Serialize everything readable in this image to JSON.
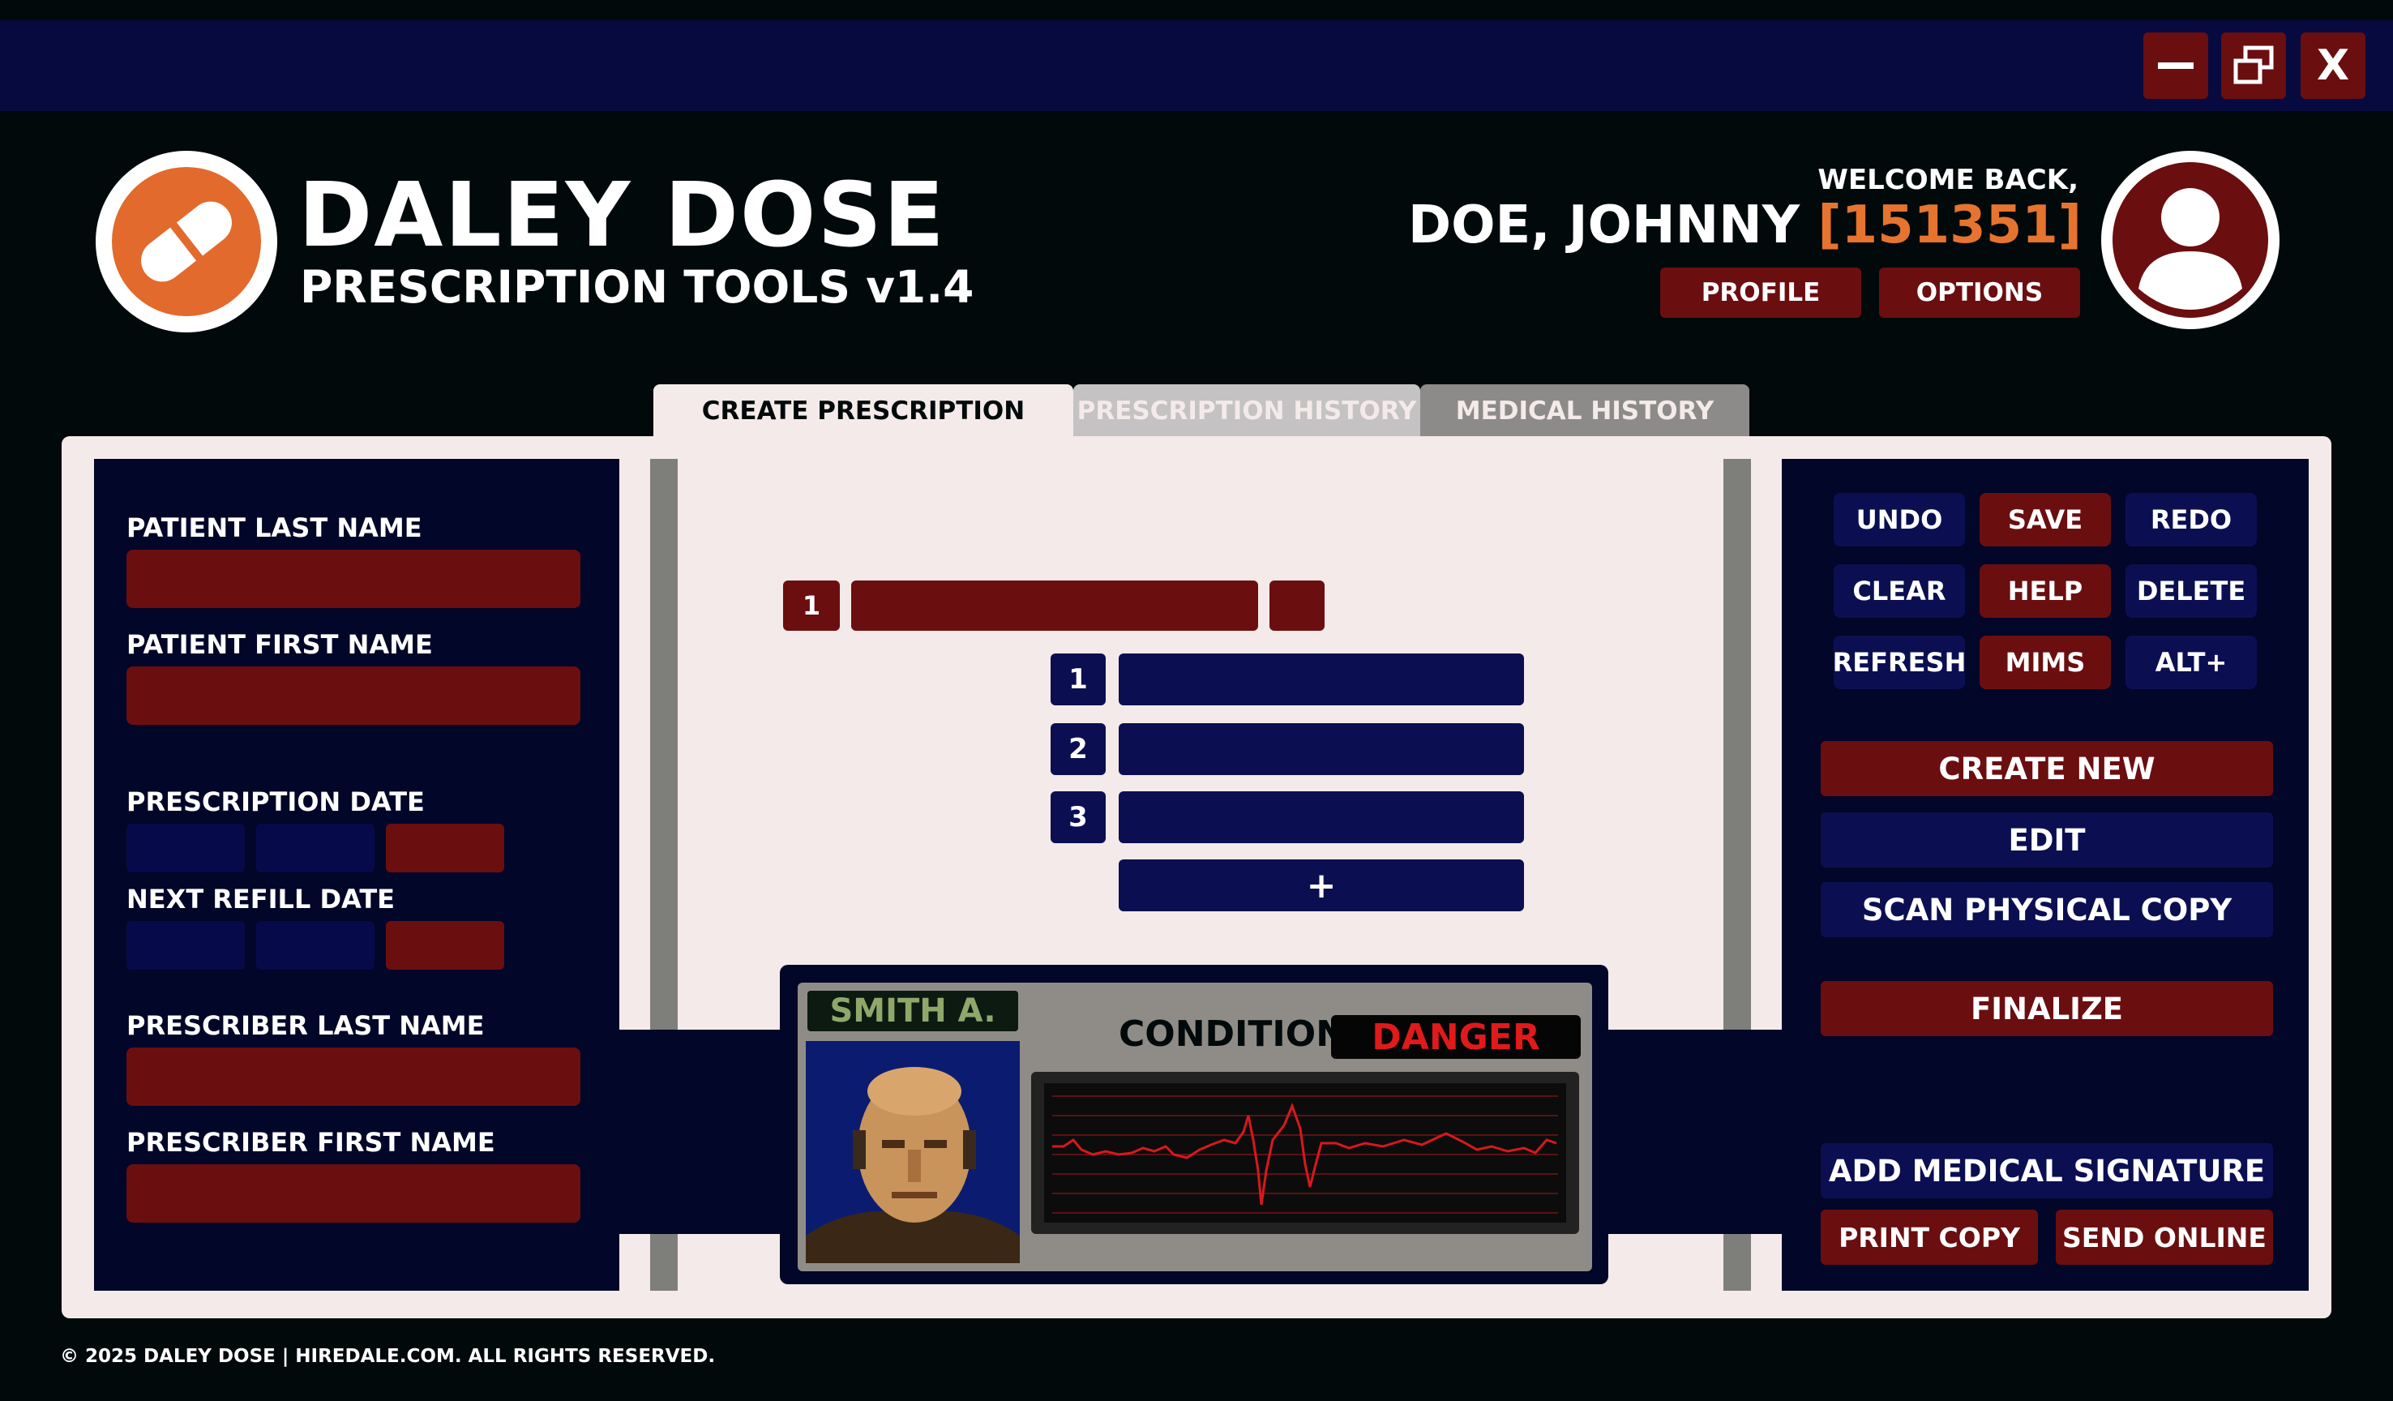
{
  "window": {
    "minimize_icon": "minimize-icon",
    "restore_icon": "restore-icon",
    "close_label": "X"
  },
  "header": {
    "title": "DALEY DOSE",
    "subtitle": "PRESCRIPTION TOOLS v1.4",
    "logo_icon": "pill-icon",
    "welcome": "WELCOME BACK,",
    "user_name": "DOE, JOHNNY",
    "user_id": "[151351]",
    "profile_label": "PROFILE",
    "options_label": "OPTIONS",
    "avatar_icon": "user-icon"
  },
  "tabs": [
    {
      "label": "CREATE PRESCRIPTION",
      "active": true
    },
    {
      "label": "PRESCRIPTION HISTORY",
      "active": false
    },
    {
      "label": "MEDICAL HISTORY",
      "active": false
    }
  ],
  "form": {
    "patient_last_name": {
      "label": "PATIENT LAST NAME",
      "value": ""
    },
    "patient_first_name": {
      "label": "PATIENT FIRST NAME",
      "value": ""
    },
    "prescription_date": {
      "label": "PRESCRIPTION DATE",
      "value": ""
    },
    "next_refill_date": {
      "label": "NEXT REFILL DATE",
      "value": ""
    },
    "prescriber_last_name": {
      "label": "PRESCRIBER LAST NAME",
      "value": ""
    },
    "prescriber_first_name": {
      "label": "PRESCRIBER FIRST NAME",
      "value": ""
    }
  },
  "prescription": {
    "item_number": "1",
    "sub_items": [
      "1",
      "2",
      "3"
    ],
    "add_label": "+"
  },
  "patient_card": {
    "name": "SMITH A.",
    "condition_label": "CONDITION",
    "condition_value": "DANGER",
    "colors": {
      "danger": "#e01a1a",
      "name": "#8fa86a",
      "ecg": "#d8181c"
    }
  },
  "actions": {
    "small": [
      {
        "label": "UNDO",
        "style": "blue"
      },
      {
        "label": "SAVE",
        "style": "red"
      },
      {
        "label": "REDO",
        "style": "blue"
      },
      {
        "label": "CLEAR",
        "style": "blue"
      },
      {
        "label": "HELP",
        "style": "red"
      },
      {
        "label": "DELETE",
        "style": "blue"
      },
      {
        "label": "REFRESH",
        "style": "blue"
      },
      {
        "label": "MIMS",
        "style": "red"
      },
      {
        "label": "ALT+",
        "style": "blue"
      }
    ],
    "create_new": "CREATE NEW",
    "edit": "EDIT",
    "scan": "SCAN PHYSICAL COPY",
    "finalize": "FINALIZE",
    "signature": "ADD MEDICAL SIGNATURE",
    "print": "PRINT COPY",
    "send": "SEND ONLINE"
  },
  "footer": "© 2025 DALEY DOSE | HIREDALE.COM. ALL RIGHTS RESERVED.",
  "theme": {
    "navy": "#070a3e",
    "maroon": "#6b0e10",
    "orange": "#e26a2c",
    "panel": "#f4eaea"
  }
}
